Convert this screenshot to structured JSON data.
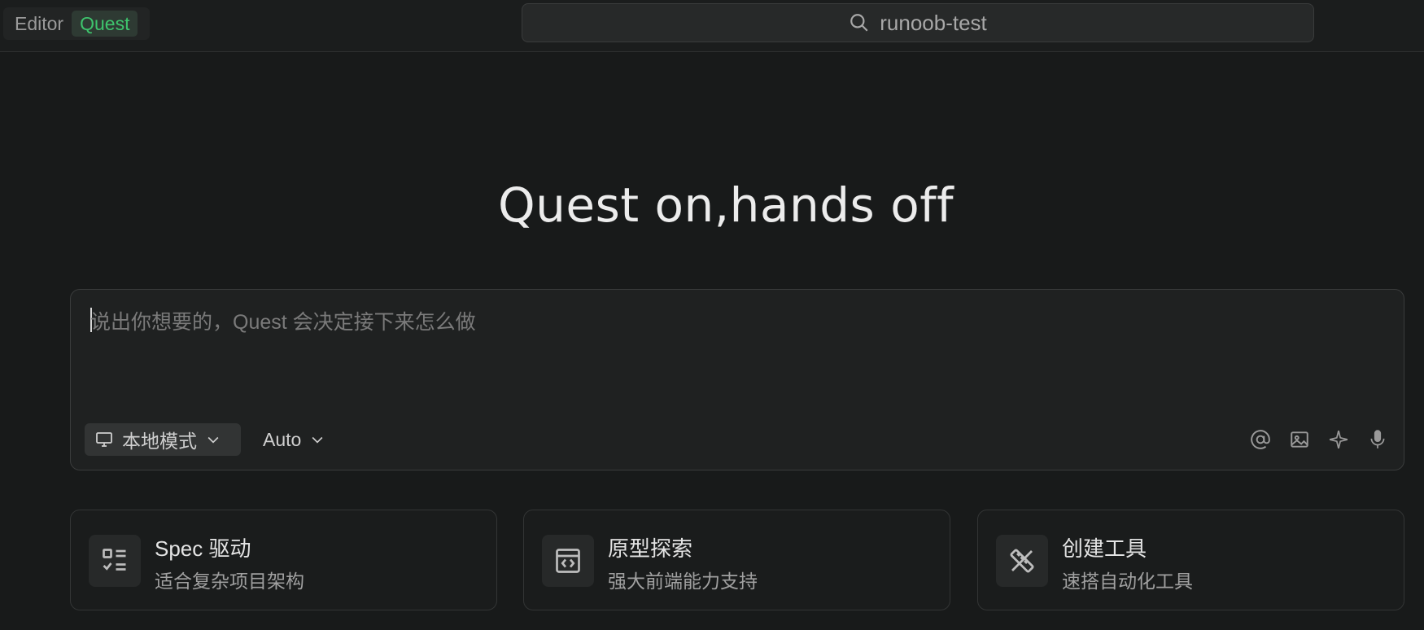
{
  "topbar": {
    "tabs": [
      {
        "label": "Editor",
        "active": false
      },
      {
        "label": "Quest",
        "active": true
      }
    ],
    "search": {
      "text": "runoob-test",
      "icon": "search-icon"
    }
  },
  "hero": {
    "title": "Quest on,hands off"
  },
  "composer": {
    "placeholder": "说出你想要的，Quest 会决定接下来怎么做",
    "mode_label": "本地模式",
    "model_label": "Auto",
    "tools": [
      "at-mention-icon",
      "image-icon",
      "sparkle-icon",
      "microphone-icon"
    ]
  },
  "cards": [
    {
      "title": "Spec 驱动",
      "subtitle": "适合复杂项目架构",
      "icon": "checklist-icon"
    },
    {
      "title": "原型探索",
      "subtitle": "强大前端能力支持",
      "icon": "code-window-icon"
    },
    {
      "title": "创建工具",
      "subtitle": "速搭自动化工具",
      "icon": "tools-icon"
    }
  ],
  "colors": {
    "background": "#181a1a",
    "accent": "#3ec46d"
  }
}
